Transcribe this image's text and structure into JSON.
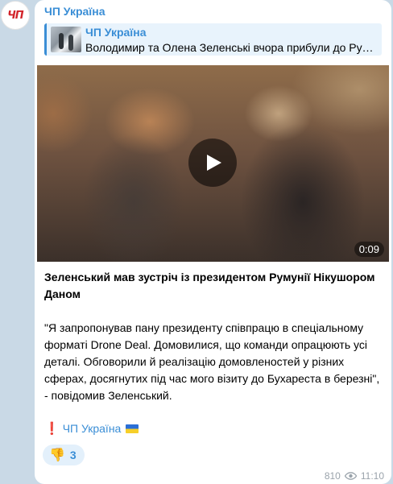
{
  "avatar": {
    "logo_text": "ЧП"
  },
  "post": {
    "channel_name": "ЧП Україна",
    "reply": {
      "title": "ЧП Україна",
      "text": "Володимир та Олена Зеленські вчора прибули до Румунії"
    },
    "video": {
      "duration": "0:09",
      "icon": "play-icon"
    },
    "caption_title": "Зеленський мав зустріч із президентом Румунії Нікушором Даном",
    "quote": "\"Я запропонував пану президенту співпрацю в спеціальному форматі Drone Deal. Домовилися, що команди опрацюють усі деталі. Обговорили й реалізацію домовленостей у різних сферах, досягнутих під час мого візиту до Бухареста в березні\", - повідомив Зеленський.",
    "signature": {
      "prefix": "❗",
      "name": "ЧП Україна",
      "flag": "ukraine-flag"
    },
    "reaction": {
      "emoji": "👎",
      "count": "3"
    },
    "views": "810",
    "time": "11:10"
  },
  "colors": {
    "accent": "#3a8ed6",
    "background": "#c9d9e6",
    "bubble": "#ffffff",
    "meta": "#9aa3ab"
  }
}
